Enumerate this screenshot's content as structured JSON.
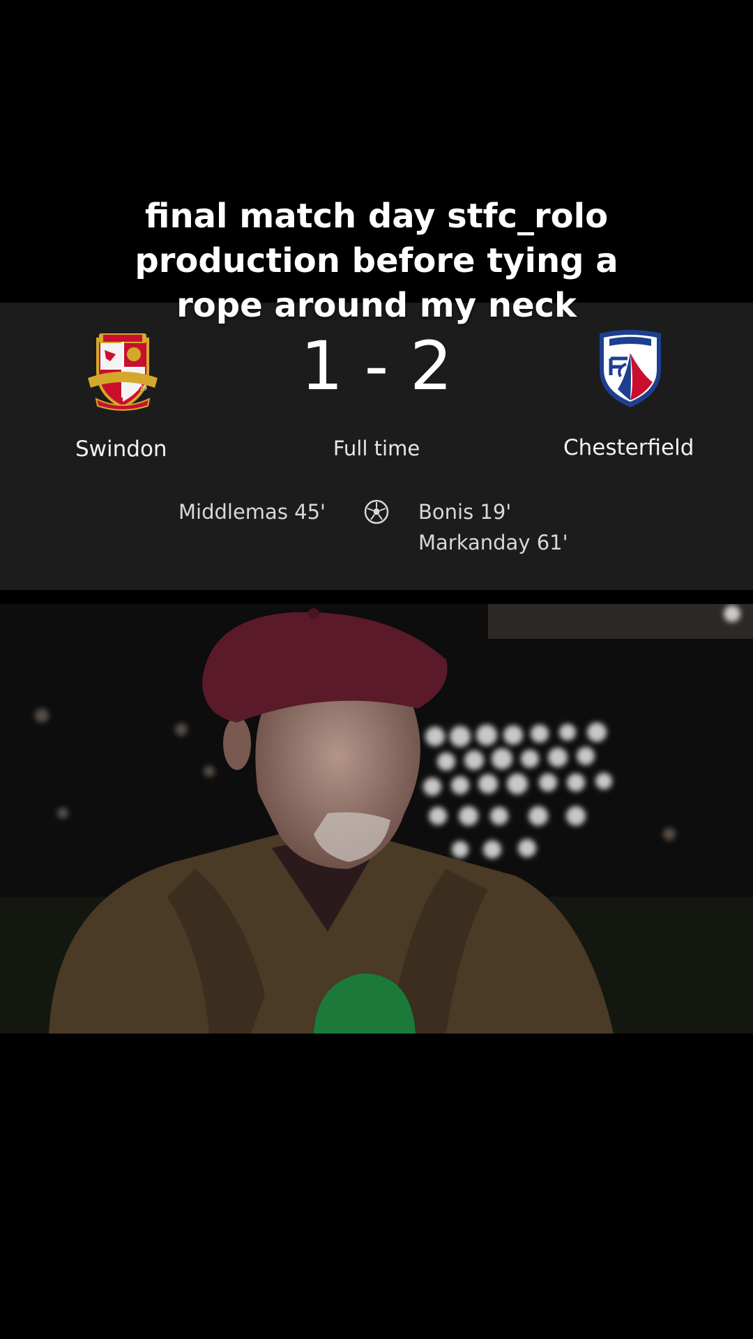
{
  "caption": {
    "lines": [
      "final match day stfc_rolo",
      "production before tying a",
      "rope around my neck"
    ]
  },
  "match": {
    "home_team": "Swindon",
    "away_team": "Chesterfield",
    "score": "1 - 2",
    "status": "Full time",
    "home_scorers": [
      "Middlemas 45'"
    ],
    "away_scorers": [
      "Bonis 19'",
      "Markanday 61'"
    ]
  },
  "colors": {
    "background": "#000000",
    "scorecard": "#1c1c1c",
    "home_crest_red": "#c8102e",
    "home_crest_gold": "#d4a82a",
    "away_crest_blue": "#1d3f8f",
    "away_crest_red": "#c8102e",
    "beret": "#5a1a2a",
    "coat": "#4a3a26",
    "microphone": "#1b7a3a"
  },
  "icons": {
    "home_crest": "swindon-crest-icon",
    "away_crest": "chesterfield-crest-icon",
    "goal": "football-icon"
  }
}
